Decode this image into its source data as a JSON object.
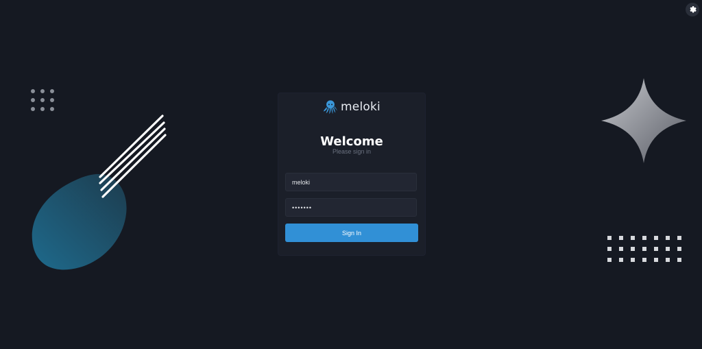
{
  "app": {
    "brand_name": "meloki",
    "brand_color": "#3a97d9",
    "logo_icon": "octopus-icon"
  },
  "login": {
    "title": "Welcome",
    "subtitle": "Please sign in",
    "username_value": "meloki",
    "password_value": "•••••••",
    "submit_label": "Sign In",
    "submit_color": "#3190d6"
  },
  "header": {
    "settings_icon": "gear-icon"
  },
  "colors": {
    "background": "#151922",
    "card": "#1b1f29",
    "input": "#222632"
  }
}
